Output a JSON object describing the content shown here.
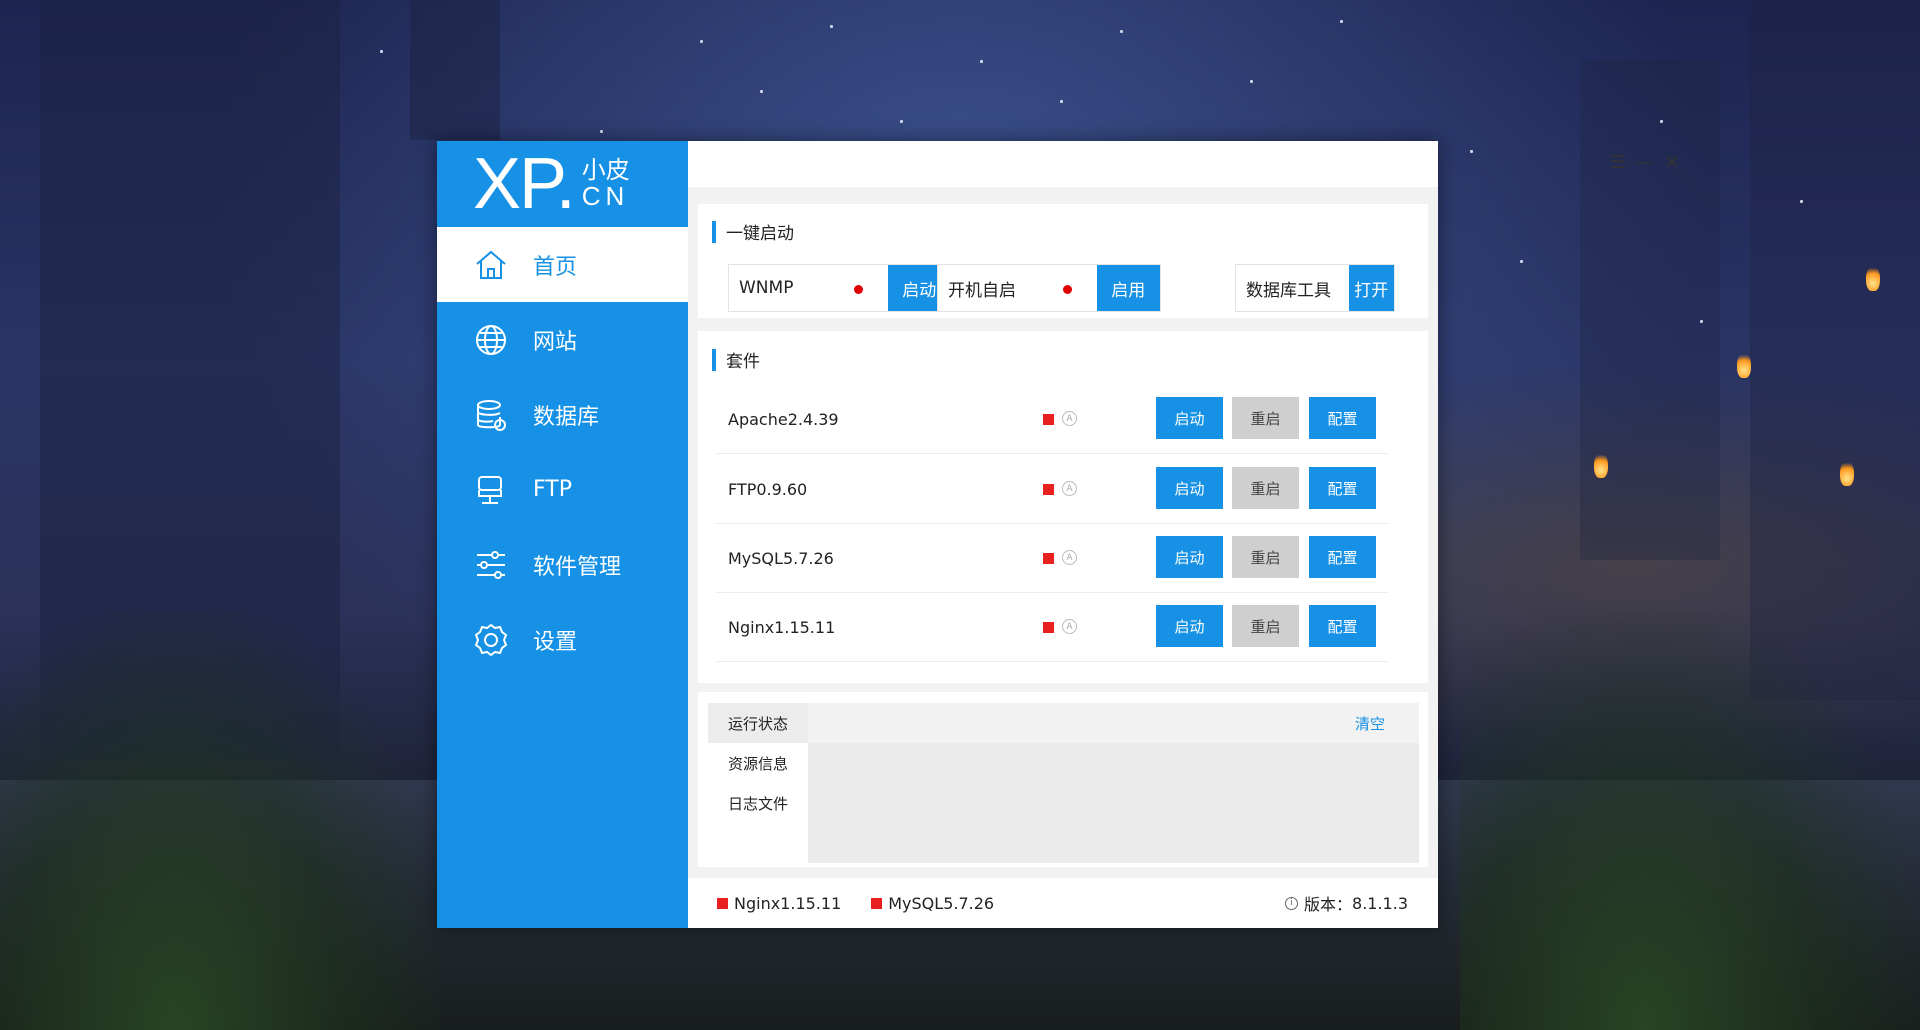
{
  "app": {
    "logo_main": "XP.",
    "logo_cn": "小皮",
    "logo_domain": "CN"
  },
  "sidebar": {
    "items": [
      {
        "label": "首页",
        "icon": "home-icon",
        "active": true
      },
      {
        "label": "网站",
        "icon": "globe-icon",
        "active": false
      },
      {
        "label": "数据库",
        "icon": "database-icon",
        "active": false
      },
      {
        "label": "FTP",
        "icon": "server-icon",
        "active": false
      },
      {
        "label": "软件管理",
        "icon": "sliders-icon",
        "active": false
      },
      {
        "label": "设置",
        "icon": "gear-icon",
        "active": false
      }
    ]
  },
  "window_controls": {
    "menu": "☰",
    "minimize": "—",
    "close": "✕"
  },
  "quick_start": {
    "title": "一键启动",
    "wnmp": {
      "label": "WNMP",
      "button": "启动",
      "status_color": "#e00000"
    },
    "autostart": {
      "label": "开机自启",
      "button": "启用",
      "status_color": "#e00000"
    },
    "db_tool": {
      "label": "数据库工具",
      "button": "打开"
    }
  },
  "suite": {
    "title": "套件",
    "rows": [
      {
        "name": "Apache2.4.39",
        "start": "启动",
        "restart": "重启",
        "config": "配置",
        "auto": "A"
      },
      {
        "name": "FTP0.9.60",
        "start": "启动",
        "restart": "重启",
        "config": "配置",
        "auto": "A"
      },
      {
        "name": "MySQL5.7.26",
        "start": "启动",
        "restart": "重启",
        "config": "配置",
        "auto": "A"
      },
      {
        "name": "Nginx1.15.11",
        "start": "启动",
        "restart": "重启",
        "config": "配置",
        "auto": "A"
      }
    ]
  },
  "log": {
    "tabs": [
      "运行状态",
      "资源信息",
      "日志文件"
    ],
    "clear": "清空"
  },
  "footer": {
    "services": [
      "Nginx1.15.11",
      "MySQL5.7.26"
    ],
    "version_label": "版本：",
    "version": "8.1.1.3",
    "info_icon": "i"
  },
  "colors": {
    "accent": "#1691e6",
    "stopped": "#e82020",
    "button_gray": "#cfcfcf"
  }
}
